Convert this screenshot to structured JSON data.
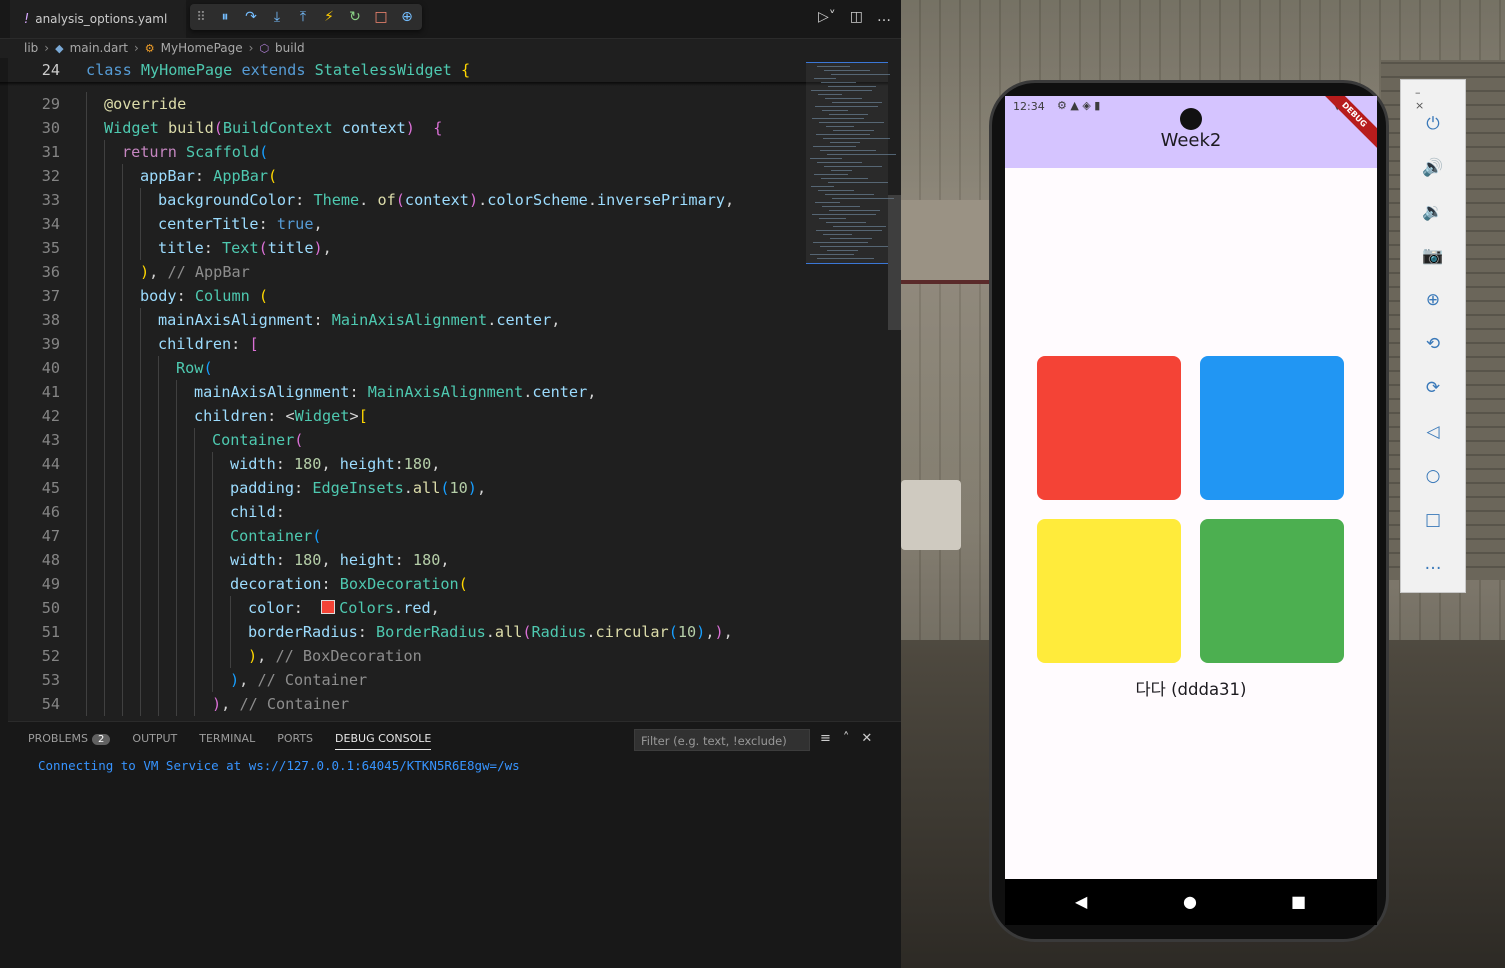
{
  "vscode": {
    "tab": {
      "icon": "!",
      "label": "analysis_options.yaml"
    },
    "debug_toolbar": [
      "grip-icon",
      "pause-icon",
      "step-over-icon",
      "step-into-icon",
      "step-out-icon",
      "hot-reload-icon",
      "restart-icon",
      "stop-icon",
      "devtools-icon"
    ],
    "debug_glyphs": [
      "⠿",
      "⏸",
      "↷",
      "⤓",
      "⤒",
      "⚡",
      "↻",
      "□",
      "⊕"
    ],
    "tab_right_glyphs": [
      "▷˅",
      "◫",
      "…"
    ],
    "breadcrumb": [
      "lib",
      "main.dart",
      "MyHomePage",
      "build"
    ],
    "code": [
      {
        "n": "24",
        "segs": [
          [
            "kw",
            "class "
          ],
          [
            "ty",
            "MyHomePage "
          ],
          [
            "kw",
            "extends "
          ],
          [
            "ty",
            "StatelessWidget "
          ],
          [
            "b1",
            "{"
          ]
        ]
      },
      {
        "n": "29",
        "segs": [
          [
            "fn",
            "@override"
          ]
        ]
      },
      {
        "n": "30",
        "segs": [
          [
            "ty",
            "Widget "
          ],
          [
            "fn",
            "build"
          ],
          [
            "b2",
            "("
          ],
          [
            "ty",
            "BuildContext "
          ],
          [
            "pr",
            "context"
          ],
          [
            "b2",
            ")"
          ],
          [
            "",
            "  "
          ],
          [
            "b2",
            "{"
          ]
        ]
      },
      {
        "n": "31",
        "segs": [
          [
            "kc",
            "return "
          ],
          [
            "ty",
            "Scaffold"
          ],
          [
            "b3",
            "("
          ]
        ]
      },
      {
        "n": "32",
        "segs": [
          [
            "pr",
            "appBar"
          ],
          [
            "",
            ": "
          ],
          [
            "ty",
            "AppBar"
          ],
          [
            "b1",
            "("
          ]
        ]
      },
      {
        "n": "33",
        "segs": [
          [
            "pr",
            "backgroundColor"
          ],
          [
            "",
            ": "
          ],
          [
            "ty",
            "Theme"
          ],
          [
            "",
            ". "
          ],
          [
            "fn",
            "of"
          ],
          [
            "b2",
            "("
          ],
          [
            "pr",
            "context"
          ],
          [
            "b2",
            ")"
          ],
          [
            "",
            "."
          ],
          [
            "pr",
            "colorScheme"
          ],
          [
            "",
            "."
          ],
          [
            "pr",
            "inversePrimary"
          ],
          [
            "",
            ","
          ]
        ]
      },
      {
        "n": "34",
        "segs": [
          [
            "pr",
            "centerTitle"
          ],
          [
            "",
            ": "
          ],
          [
            "kw",
            "true"
          ],
          [
            "",
            ","
          ]
        ]
      },
      {
        "n": "35",
        "segs": [
          [
            "pr",
            "title"
          ],
          [
            "",
            ": "
          ],
          [
            "ty",
            "Text"
          ],
          [
            "b2",
            "("
          ],
          [
            "pr",
            "title"
          ],
          [
            "b2",
            ")"
          ],
          [
            "",
            ","
          ]
        ]
      },
      {
        "n": "36",
        "segs": [
          [
            "b1",
            ")"
          ],
          [
            "",
            ", "
          ],
          [
            "cm",
            "// AppBar"
          ]
        ]
      },
      {
        "n": "37",
        "segs": [
          [
            "pr",
            "body"
          ],
          [
            "",
            ": "
          ],
          [
            "ty",
            "Column "
          ],
          [
            "b1",
            "("
          ]
        ]
      },
      {
        "n": "38",
        "segs": [
          [
            "pr",
            "mainAxisAlignment"
          ],
          [
            "",
            ": "
          ],
          [
            "ty",
            "MainAxisAlignment"
          ],
          [
            "",
            "."
          ],
          [
            "pr",
            "center"
          ],
          [
            "",
            ","
          ]
        ]
      },
      {
        "n": "39",
        "segs": [
          [
            "pr",
            "children"
          ],
          [
            "",
            ": "
          ],
          [
            "b2",
            "["
          ]
        ]
      },
      {
        "n": "40",
        "segs": [
          [
            "ty",
            "Row"
          ],
          [
            "b3",
            "("
          ]
        ]
      },
      {
        "n": "41",
        "segs": [
          [
            "pr",
            "mainAxisAlignment"
          ],
          [
            "",
            ": "
          ],
          [
            "ty",
            "MainAxisAlignment"
          ],
          [
            "",
            "."
          ],
          [
            "pr",
            "center"
          ],
          [
            "",
            ","
          ]
        ]
      },
      {
        "n": "42",
        "segs": [
          [
            "pr",
            "children"
          ],
          [
            "",
            ": <"
          ],
          [
            "ty",
            "Widget"
          ],
          [
            "",
            ">"
          ],
          [
            "b1",
            "["
          ]
        ]
      },
      {
        "n": "43",
        "segs": [
          [
            "ty",
            "Container"
          ],
          [
            "b2",
            "("
          ]
        ]
      },
      {
        "n": "44",
        "segs": [
          [
            "pr",
            "width"
          ],
          [
            "",
            ": "
          ],
          [
            "nm",
            "180"
          ],
          [
            "",
            ", "
          ],
          [
            "pr",
            "height"
          ],
          [
            "",
            ":"
          ],
          [
            "nm",
            "180"
          ],
          [
            "",
            ","
          ]
        ]
      },
      {
        "n": "45",
        "segs": [
          [
            "pr",
            "padding"
          ],
          [
            "",
            ": "
          ],
          [
            "ty",
            "EdgeInsets"
          ],
          [
            "",
            "."
          ],
          [
            "fn",
            "all"
          ],
          [
            "b3",
            "("
          ],
          [
            "nm",
            "10"
          ],
          [
            "b3",
            ")"
          ],
          [
            "",
            ","
          ]
        ]
      },
      {
        "n": "46",
        "segs": [
          [
            "pr",
            "child"
          ],
          [
            "",
            ":"
          ]
        ]
      },
      {
        "n": "47",
        "segs": [
          [
            "ty",
            "Container"
          ],
          [
            "b3",
            "("
          ]
        ]
      },
      {
        "n": "48",
        "segs": [
          [
            "pr",
            "width"
          ],
          [
            "",
            ": "
          ],
          [
            "nm",
            "180"
          ],
          [
            "",
            ", "
          ],
          [
            "pr",
            "height"
          ],
          [
            "",
            ": "
          ],
          [
            "nm",
            "180"
          ],
          [
            "",
            ","
          ]
        ]
      },
      {
        "n": "49",
        "segs": [
          [
            "pr",
            "decoration"
          ],
          [
            "",
            ": "
          ],
          [
            "ty",
            "BoxDecoration"
          ],
          [
            "b1",
            "("
          ]
        ]
      },
      {
        "n": "50",
        "segs": [
          [
            "pr",
            "color"
          ],
          [
            "",
            ":  "
          ],
          [
            "swatch",
            ""
          ],
          [
            "ty",
            "Colors"
          ],
          [
            "",
            "."
          ],
          [
            "pr",
            "red"
          ],
          [
            "",
            ","
          ]
        ]
      },
      {
        "n": "51",
        "segs": [
          [
            "pr",
            "borderRadius"
          ],
          [
            "",
            ": "
          ],
          [
            "ty",
            "BorderRadius"
          ],
          [
            "",
            "."
          ],
          [
            "fn",
            "all"
          ],
          [
            "b2",
            "("
          ],
          [
            "ty",
            "Radius"
          ],
          [
            "",
            "."
          ],
          [
            "fn",
            "circular"
          ],
          [
            "b3",
            "("
          ],
          [
            "nm",
            "10"
          ],
          [
            "b3",
            ")"
          ],
          [
            "",
            ","
          ],
          [
            "b2",
            ")"
          ],
          [
            "",
            ","
          ]
        ]
      },
      {
        "n": "52",
        "segs": [
          [
            "b1",
            ")"
          ],
          [
            "",
            ", "
          ],
          [
            "cm",
            "// BoxDecoration"
          ]
        ]
      },
      {
        "n": "53",
        "segs": [
          [
            "b3",
            ")"
          ],
          [
            "",
            ", "
          ],
          [
            "cm",
            "// Container"
          ]
        ]
      },
      {
        "n": "54",
        "segs": [
          [
            "b2",
            ")"
          ],
          [
            "",
            ", "
          ],
          [
            "cm",
            "// Container"
          ]
        ]
      }
    ],
    "panel": {
      "tabs": [
        "PROBLEMS",
        "OUTPUT",
        "TERMINAL",
        "PORTS",
        "DEBUG CONSOLE"
      ],
      "problems_count": "2",
      "filter_placeholder": "Filter (e.g. text, !exclude)",
      "console_text": "Connecting to VM Service at ws://127.0.0.1:64045/KTKN5R6E8gw=/ws"
    }
  },
  "emulator": {
    "status_time": "12:34",
    "app_title": "Week2",
    "debug_banner": "DEBUG",
    "boxes": [
      {
        "name": "red-box",
        "color": "#f44336"
      },
      {
        "name": "blue-box",
        "color": "#2196f3"
      },
      {
        "name": "yellow-box",
        "color": "#ffeb3b"
      },
      {
        "name": "green-box",
        "color": "#4caf50"
      }
    ],
    "caption": "다다 (ddda31)",
    "appbar_color": "#d5c4ff",
    "nav": [
      "◀",
      "●",
      "■"
    ],
    "side_panel": {
      "window_controls": "–  ×",
      "buttons": [
        {
          "name": "power-icon",
          "glyph": "⏻"
        },
        {
          "name": "volume-up-icon",
          "glyph": "🔊"
        },
        {
          "name": "volume-down-icon",
          "glyph": "🔉"
        },
        {
          "name": "camera-icon",
          "glyph": "📷"
        },
        {
          "name": "zoom-icon",
          "glyph": "⊕"
        },
        {
          "name": "rotate-left-icon",
          "glyph": "⟲"
        },
        {
          "name": "rotate-right-icon",
          "glyph": "⟳"
        },
        {
          "name": "back-icon",
          "glyph": "◁"
        },
        {
          "name": "home-icon",
          "glyph": "○"
        },
        {
          "name": "overview-icon",
          "glyph": "□"
        },
        {
          "name": "more-icon",
          "glyph": "…"
        }
      ]
    }
  }
}
